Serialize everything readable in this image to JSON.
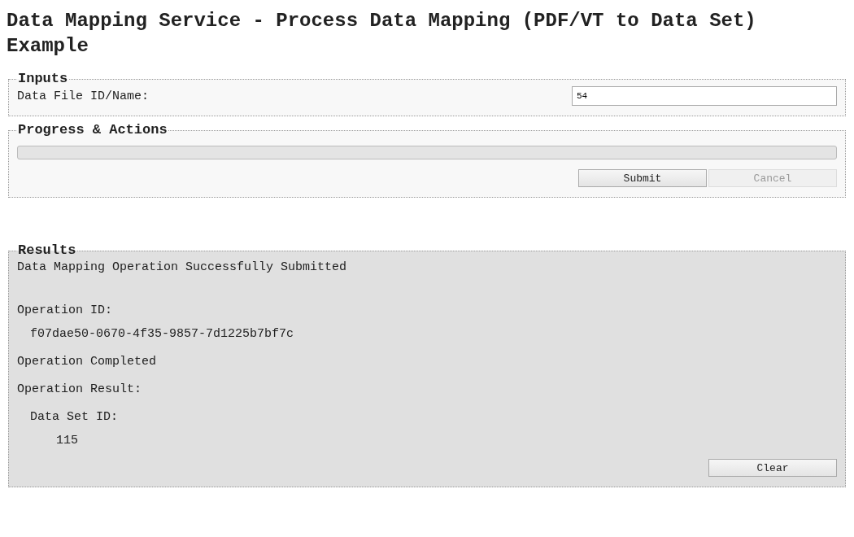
{
  "title": "Data Mapping Service - Process Data Mapping (PDF/VT to Data Set) Example",
  "inputs": {
    "legend": "Inputs",
    "field_label": "Data File ID/Name:",
    "value": "54"
  },
  "progress": {
    "legend": "Progress & Actions",
    "level": 0,
    "buttons": [
      {
        "label": "Submit",
        "disabled": false
      },
      {
        "label": "Cancel",
        "disabled": true
      }
    ]
  },
  "results": {
    "legend": "Results",
    "lines": [
      {
        "kind": "message",
        "text": "Data Mapping Operation Successfully Submitted"
      },
      {
        "kind": "label",
        "text": "Operation ID:"
      },
      {
        "kind": "value",
        "text": "f07dae50-0670-4f35-9857-7d1225b7bf7c"
      },
      {
        "kind": "label",
        "text": "Operation Completed"
      },
      {
        "kind": "label",
        "text": "Operation Result:"
      },
      {
        "kind": "sublabel",
        "text": "Data Set ID:"
      },
      {
        "kind": "subvalue",
        "text": "115"
      }
    ],
    "button": {
      "label": "Clear",
      "disabled": false
    }
  }
}
